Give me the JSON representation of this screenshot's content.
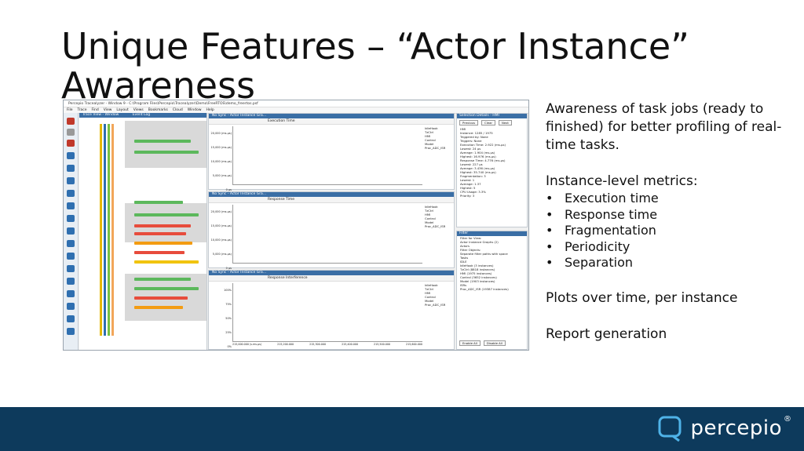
{
  "slide": {
    "title": "Unique Features – “Actor Instance” Awareness",
    "intro": "Awareness of task jobs (ready to finished)  for better profiling of real-time tasks.",
    "metrics_heading": "Instance-level metrics:",
    "metrics": [
      "Execution time",
      "Response time",
      "Fragmentation",
      "Periodicity",
      "Separation"
    ],
    "plots_note": "Plots over time, per instance",
    "report_note": "Report generation"
  },
  "brand": {
    "logo_text": "percepio",
    "registered_mark": "®",
    "footer_color": "#0d3a5c"
  },
  "screenshot": {
    "window_title": "Percepio Tracealyzer - Window 9 - C:\\Program Files\\Percepio\\Tracealyzer\\Demo\\FreeRTOS\\demo_freertos.psf",
    "menu": [
      "File",
      "Trace",
      "Find",
      "View",
      "Layout",
      "Views",
      "Bookmarks",
      "Cloud",
      "Window",
      "Help"
    ],
    "panels": {
      "trace_view": "Trace View - Window",
      "event_log": "Event Log",
      "plot1_header": "No Sync - Actor Instance Gra...",
      "plot1_metric": "Execution Time",
      "plot2_header": "No Sync - Actor Instance Gra...",
      "plot2_metric": "Response Time",
      "plot3_header": "No Sync - Actor Instance Gra...",
      "plot3_metric": "Response Interference",
      "selection_details": "Selection Details - HMI",
      "filter": "Filter"
    },
    "legend": [
      "IdleHook",
      "TzCtrl",
      "HMI",
      "Control",
      "Model",
      "Proc_ADC_ISR"
    ],
    "plot1_yticks": [
      "20,000 (ms.µs)",
      "15,000 (ms.µs)",
      "10,000 (ms.µs)",
      "5,000 (ms.µs)",
      "0 µs"
    ],
    "plot2_yticks": [
      "20,000 (ms.µs)",
      "15,000 (ms.µs)",
      "10,000 (ms.µs)",
      "5,000 (ms.µs)",
      "0 µs"
    ],
    "plot3_yticks": [
      "100%",
      "75%",
      "50%",
      "25%",
      "0%"
    ],
    "xticks": [
      "215,000.000 (s.ms.µs)",
      "215,200.000",
      "215,300.000",
      "215,400.000",
      "215,500.000",
      "215,600.000"
    ],
    "selection_buttons": [
      "Previous",
      "Clear",
      "Next"
    ],
    "selection_details_lines": [
      "HMI",
      "Instance: 1285 / 1975",
      "Triggered by: None",
      "Triggers: None",
      "Execution Time: 2.922 (ms.µs)",
      "Lowest: 24 µs",
      "Average: 1.904 (ms.µs)",
      "Highest: 16.976 (ms.µs)",
      "Response Time: 4.776 (ms.µs)",
      "Lowest: 227 µs",
      "Average: 3.436 (ms.µs)",
      "Highest: 35.740 (ms.µs)",
      "Fragmentation: 3",
      "Lowest: 1",
      "Average: 1.37",
      "Highest: 5",
      "CPU Usage: 3.3%",
      "Priority: 3"
    ],
    "filter_lines": [
      "Filter for View:",
      "Actor Instance Graphs (2)",
      "Actors",
      "Filter Objects:",
      "Separate filter paths with space",
      "Tasks",
      "IDLE",
      "IdleHook (3 instances)",
      "TzCtrl (8818 instances)",
      "HMI (1975 instances)",
      "Control (3652 instances)",
      "Model (1903 instances)",
      "ISRs",
      "Proc_ADC_ISR (19387 instances)"
    ],
    "filter_buttons": [
      "Enable All",
      "Disable All"
    ]
  }
}
